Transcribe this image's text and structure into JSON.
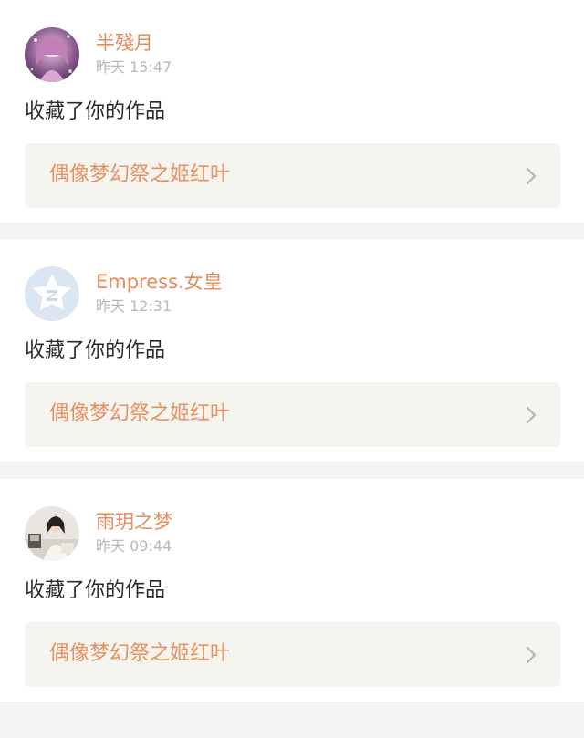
{
  "notifications": [
    {
      "username": "半殘月",
      "timestamp": "昨天 15:47",
      "action": "收藏了你的作品",
      "work_title": "偶像梦幻祭之姬红叶",
      "avatar_icon": "anime-girl-avatar"
    },
    {
      "username": "Empress.女皇",
      "timestamp": "昨天 12:31",
      "action": "收藏了你的作品",
      "work_title": "偶像梦幻祭之姬红叶",
      "avatar_icon": "default-star-avatar"
    },
    {
      "username": "雨玥之梦",
      "timestamp": "昨天 09:44",
      "action": "收藏了你的作品",
      "work_title": "偶像梦幻祭之姬红叶",
      "avatar_icon": "photo-person-avatar"
    }
  ],
  "colors": {
    "username": "#e48c5a",
    "work_title": "#e59060",
    "timestamp": "#b8b8b8",
    "link_background": "#f5f4ef",
    "page_background": "#f4f4f4"
  }
}
